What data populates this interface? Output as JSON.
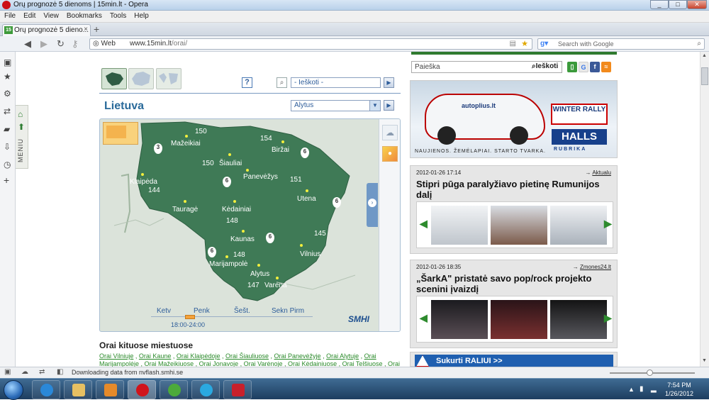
{
  "window": {
    "title": "Orų prognozė 5 dienoms | 15min.lt - Opera",
    "buttons": [
      "_",
      "□",
      "✕"
    ]
  },
  "menu": [
    "File",
    "Edit",
    "View",
    "Bookmarks",
    "Tools",
    "Help"
  ],
  "tab": {
    "favicon": "15",
    "label": "Orų prognozė 5 dieno...",
    "close": "×",
    "new_tab": "+"
  },
  "nav": {
    "web_label": "Web",
    "url_host": "www.15min.lt",
    "url_path": "/orai/",
    "search_placeholder": "Search with Google"
  },
  "sidebar": {
    "menu_label": "MENIU"
  },
  "map": {
    "help": "?",
    "search_value": "- Ieškoti -",
    "region_title": "Lietuva",
    "city_selected": "Alytus",
    "timeline_labels": [
      "Ketv",
      "Penk",
      "Šešt.",
      "Sekn Pirm"
    ],
    "timeline_time": "18:00-24:00",
    "provider": "SMHI",
    "cities": [
      "Klaipėda",
      "Mažeikiai",
      "Šiauliai",
      "Biržai",
      "Panevėžys",
      "Utena",
      "Tauragė",
      "Kėdainiai",
      "Kaunas",
      "Vilnius",
      "Marijampolė",
      "Alytus",
      "Varėna"
    ],
    "values": [
      "150",
      "154",
      "150",
      "144",
      "151",
      "148",
      "145",
      "148",
      "147"
    ],
    "pins": [
      "3",
      "6",
      "6",
      "6",
      "6",
      "6",
      "6"
    ]
  },
  "other_cities": {
    "heading": "Orai kituose miestuose",
    "links": [
      "Orai Vilniuje",
      "Orai Kaune",
      "Orai Klaipėdoje",
      "Orai Šiauliuose",
      "Orai Panevėžyje",
      "Orai Alytuje",
      "Orai Marijampolėje",
      "Orai Mažeikiuose",
      "Orai Jonavoje",
      "Orai Varėnoje",
      "Orai Kėdainiuose",
      "Orai Telšiuose",
      "Orai"
    ]
  },
  "right": {
    "search_placeholder": "Paieška",
    "search_button": "Ieškoti",
    "banner": {
      "winter": "WINTER RALLY",
      "brand": "HALLS",
      "rubrika": "RUBRIKA",
      "footer": "NAUJIENOS. ŽEMĖLAPIAI. STARTO TVARKA.",
      "car_text": "autoplius.lt"
    },
    "news": [
      {
        "date": "2012-01-26 17:14",
        "source": "Aktualu",
        "headline": "Stipri pūga paralyžiavo pietinę Rumunijos dalį"
      },
      {
        "date": "2012-01-26 18:35",
        "source": "Zmones24.lt",
        "headline": "„ŠarkA\" pristatė savo pop/rock projekto scenini įvaizdį"
      }
    ],
    "promo": "Sukurti RALIUI >>"
  },
  "status": {
    "text": "Downloading data from nvflash.smhi.se"
  },
  "taskbar": {
    "time": "7:54 PM",
    "date": "1/26/2012"
  },
  "colors": {
    "map_land": "#3f7a56",
    "map_water": "#dbe3da",
    "accent_green": "#2f7a2f",
    "link_blue": "#2e5d9a"
  }
}
